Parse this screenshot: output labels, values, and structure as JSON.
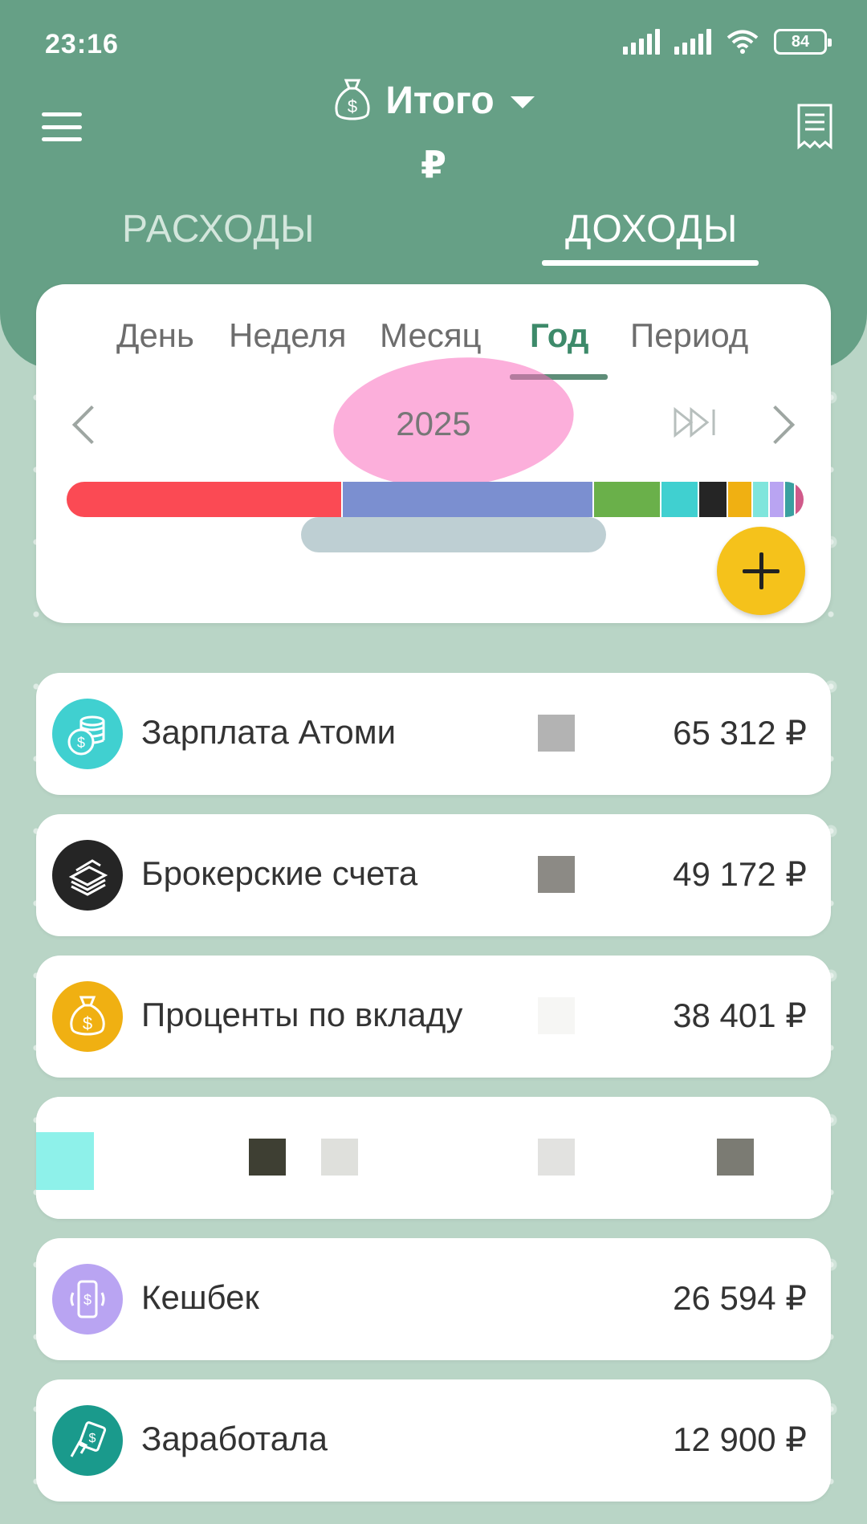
{
  "status_bar": {
    "time": "23:16",
    "battery": "84"
  },
  "header": {
    "title": "Итого",
    "currency": "₽",
    "tabs": [
      "РАСХОДЫ",
      "ДОХОДЫ"
    ],
    "active_tab": "ДОХОДЫ"
  },
  "periods": {
    "items": [
      "День",
      "Неделя",
      "Месяц",
      "Год",
      "Период"
    ],
    "active": "Год"
  },
  "year_label": "2025",
  "colors": {
    "header": "#66a086",
    "accent": "#3d8a6a",
    "fab": "#f5c21b"
  },
  "category_bar": [
    {
      "color": "#fb4a54",
      "fraction": 0.33
    },
    {
      "color": "#7b8fd0",
      "fraction": 0.3
    },
    {
      "color": "#6ab04a",
      "fraction": 0.08
    },
    {
      "color": "#40d0d0",
      "fraction": 0.045
    },
    {
      "color": "#252525",
      "fraction": 0.035
    },
    {
      "color": "#f0b012",
      "fraction": 0.03
    },
    {
      "color": "#7fe5dc",
      "fraction": 0.02
    },
    {
      "color": "#b9a4f2",
      "fraction": 0.018
    },
    {
      "color": "#3aa0a0",
      "fraction": 0.012
    },
    {
      "color": "#d05a8a",
      "fraction": 0.01
    }
  ],
  "income_items": [
    {
      "name": "Зарплата Атоми",
      "amount": "65 312 ₽",
      "icon": "coins-icon",
      "color": "#40d0d0"
    },
    {
      "name": "Брокерские счета",
      "amount": "49 172 ₽",
      "icon": "cash-stack-icon",
      "color": "#252525"
    },
    {
      "name": "Проценты по вкладу",
      "amount": "38 401 ₽",
      "icon": "money-bag-icon",
      "color": "#f0b012"
    },
    {
      "name": "Кешбек",
      "amount": "26 594 ₽",
      "icon": "phone-money-icon",
      "color": "#b9a4f2"
    },
    {
      "name": "Заработала",
      "amount": "12 900 ₽",
      "icon": "hand-money-icon",
      "color": "#1a9a8c"
    }
  ]
}
